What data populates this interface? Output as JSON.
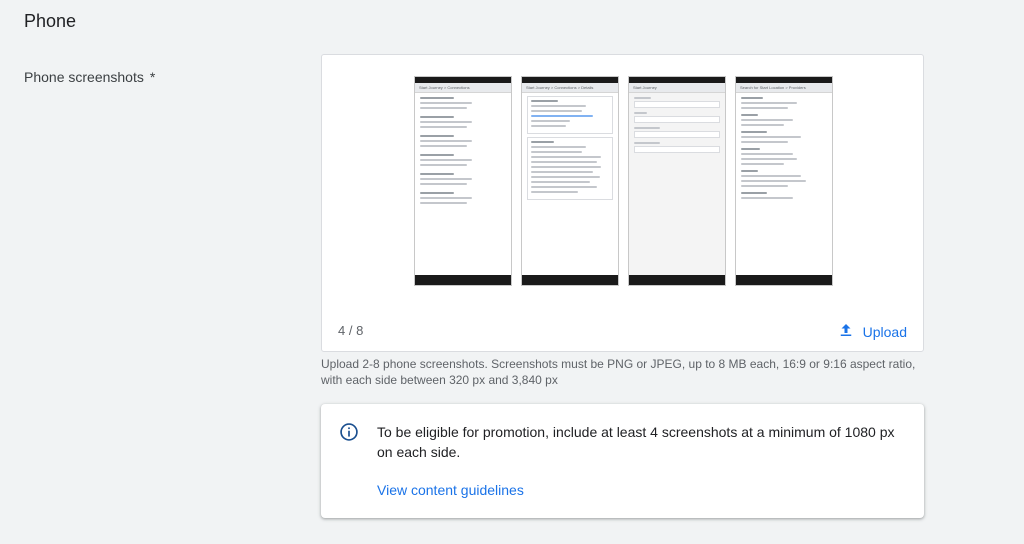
{
  "section": {
    "title": "Phone"
  },
  "field": {
    "label": "Phone screenshots",
    "required_mark": "*"
  },
  "screenshots": {
    "count_text": "4 / 8",
    "upload_label": "Upload",
    "items": [
      {
        "app_bar": "Start Journey > Connections"
      },
      {
        "app_bar": "Start Journey > Connections > Details"
      },
      {
        "app_bar": "Start Journey"
      },
      {
        "app_bar": "Search for Start Location > Providers"
      }
    ]
  },
  "help_text": "Upload 2-8 phone screenshots. Screenshots must be PNG or JPEG, up to 8 MB each, 16:9 or 9:16 aspect ratio, with each side between 320 px and 3,840 px",
  "promo": {
    "text": "To be eligible for promotion, include at least 4 screenshots at a minimum of 1080 px on each side.",
    "link": "View content guidelines"
  },
  "colors": {
    "accent": "#1a73e8",
    "background": "#f1f3f4"
  },
  "icons": {
    "upload": "upload-icon",
    "info": "info-icon"
  }
}
